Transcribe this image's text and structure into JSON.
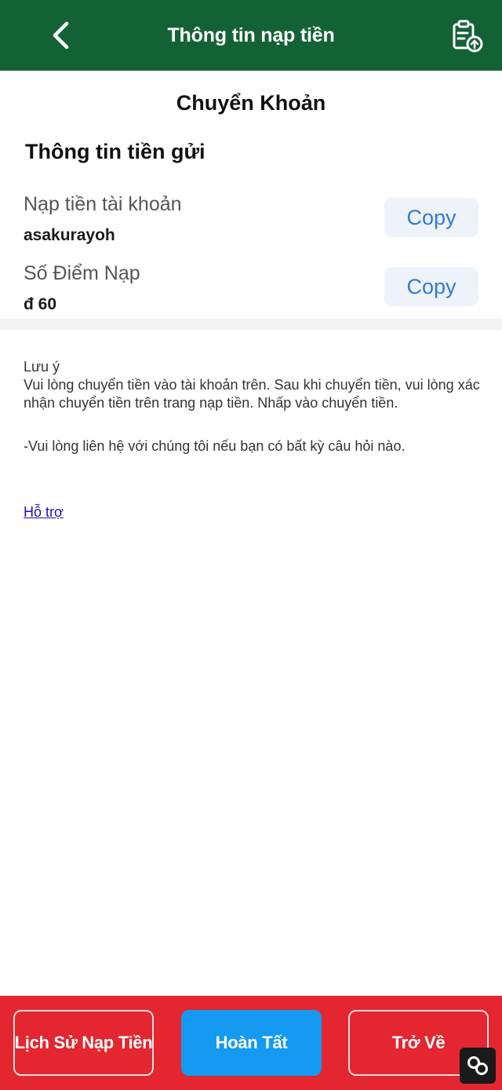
{
  "header": {
    "title": "Thông tin nạp tiền",
    "back_icon": "chevron-left-icon",
    "record_icon": "clipboard-upload-icon",
    "background": "#136235"
  },
  "transfer": {
    "method_title": "Chuyển Khoản",
    "section_heading": "Thông tin tiền gửi",
    "rows": [
      {
        "label": "Nạp tiền tài khoản",
        "value": "asakurayoh",
        "copy_label": "Copy"
      },
      {
        "label": "Số Điểm Nạp",
        "value": "đ 60",
        "copy_label": "Copy"
      }
    ]
  },
  "note": {
    "title": "Lưu ý",
    "line1": "Vui lòng chuyển tiền vào tài khoản trên. Sau khi chuyển tiền, vui lòng xác nhận chuyển tiền trên trang nạp tiền. Nhấp vào chuyển tiền.",
    "line2": "-Vui lòng liên hệ với chúng tôi nếu bạn có bất kỳ câu hỏi nào.",
    "support_link": "Hỗ trợ"
  },
  "footer": {
    "history_label": "Lịch Sử Nạp Tiền",
    "done_label": "Hoàn Tất",
    "back_label": "Trở Về",
    "background": "#e3262f",
    "primary_color": "#159af2"
  },
  "floating": {
    "icon": "link-icon"
  }
}
